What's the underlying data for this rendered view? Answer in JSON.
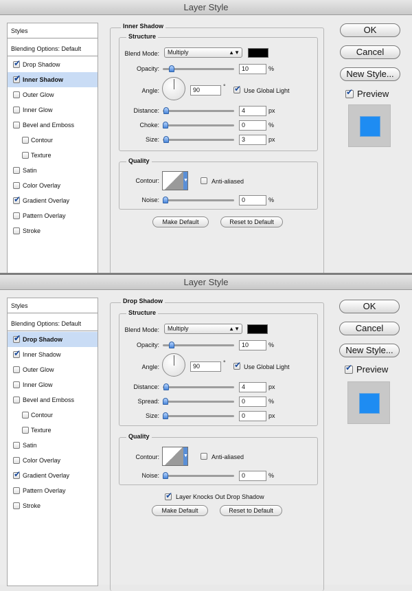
{
  "dialogs": [
    {
      "title": "Layer Style",
      "sidebar": {
        "header": "Styles",
        "blending": "Blending Options: Default",
        "items": [
          {
            "label": "Drop Shadow",
            "checked": true,
            "selected": false,
            "sub": false
          },
          {
            "label": "Inner Shadow",
            "checked": true,
            "selected": true,
            "sub": false
          },
          {
            "label": "Outer Glow",
            "checked": false,
            "selected": false,
            "sub": false
          },
          {
            "label": "Inner Glow",
            "checked": false,
            "selected": false,
            "sub": false
          },
          {
            "label": "Bevel and Emboss",
            "checked": false,
            "selected": false,
            "sub": false
          },
          {
            "label": "Contour",
            "checked": false,
            "selected": false,
            "sub": true
          },
          {
            "label": "Texture",
            "checked": false,
            "selected": false,
            "sub": true
          },
          {
            "label": "Satin",
            "checked": false,
            "selected": false,
            "sub": false
          },
          {
            "label": "Color Overlay",
            "checked": false,
            "selected": false,
            "sub": false
          },
          {
            "label": "Gradient Overlay",
            "checked": true,
            "selected": false,
            "sub": false
          },
          {
            "label": "Pattern Overlay",
            "checked": false,
            "selected": false,
            "sub": false
          },
          {
            "label": "Stroke",
            "checked": false,
            "selected": false,
            "sub": false
          }
        ]
      },
      "panel_title": "Inner Shadow",
      "structure": {
        "title": "Structure",
        "blend_mode_label": "Blend Mode:",
        "blend_mode_value": "Multiply",
        "color": "#000000",
        "opacity_label": "Opacity:",
        "opacity_value": "10",
        "opacity_unit": "%",
        "angle_label": "Angle:",
        "angle_value": "90",
        "angle_unit": "°",
        "use_global_light": "Use Global Light",
        "distance_label": "Distance:",
        "distance_value": "4",
        "distance_unit": "px",
        "third_label": "Choke:",
        "third_value": "0",
        "third_unit": "%",
        "size_label": "Size:",
        "size_value": "3",
        "size_unit": "px"
      },
      "quality": {
        "title": "Quality",
        "contour_label": "Contour:",
        "anti_aliased": "Anti-aliased",
        "noise_label": "Noise:",
        "noise_value": "0",
        "noise_unit": "%"
      },
      "make_default": "Make Default",
      "reset_to_default": "Reset to Default",
      "buttons": {
        "ok": "OK",
        "cancel": "Cancel",
        "new_style": "New Style...",
        "preview": "Preview"
      },
      "preview_color": "#1e8cf2"
    },
    {
      "title": "Layer Style",
      "sidebar": {
        "header": "Styles",
        "blending": "Blending Options: Default",
        "items": [
          {
            "label": "Drop Shadow",
            "checked": true,
            "selected": true,
            "sub": false
          },
          {
            "label": "Inner Shadow",
            "checked": true,
            "selected": false,
            "sub": false
          },
          {
            "label": "Outer Glow",
            "checked": false,
            "selected": false,
            "sub": false
          },
          {
            "label": "Inner Glow",
            "checked": false,
            "selected": false,
            "sub": false
          },
          {
            "label": "Bevel and Emboss",
            "checked": false,
            "selected": false,
            "sub": false
          },
          {
            "label": "Contour",
            "checked": false,
            "selected": false,
            "sub": true
          },
          {
            "label": "Texture",
            "checked": false,
            "selected": false,
            "sub": true
          },
          {
            "label": "Satin",
            "checked": false,
            "selected": false,
            "sub": false
          },
          {
            "label": "Color Overlay",
            "checked": false,
            "selected": false,
            "sub": false
          },
          {
            "label": "Gradient Overlay",
            "checked": true,
            "selected": false,
            "sub": false
          },
          {
            "label": "Pattern Overlay",
            "checked": false,
            "selected": false,
            "sub": false
          },
          {
            "label": "Stroke",
            "checked": false,
            "selected": false,
            "sub": false
          }
        ]
      },
      "panel_title": "Drop Shadow",
      "structure": {
        "title": "Structure",
        "blend_mode_label": "Blend Mode:",
        "blend_mode_value": "Multiply",
        "color": "#000000",
        "opacity_label": "Opacity:",
        "opacity_value": "10",
        "opacity_unit": "%",
        "angle_label": "Angle:",
        "angle_value": "90",
        "angle_unit": "°",
        "use_global_light": "Use Global Light",
        "distance_label": "Distance:",
        "distance_value": "4",
        "distance_unit": "px",
        "third_label": "Spread:",
        "third_value": "0",
        "third_unit": "%",
        "size_label": "Size:",
        "size_value": "0",
        "size_unit": "px"
      },
      "quality": {
        "title": "Quality",
        "contour_label": "Contour:",
        "anti_aliased": "Anti-aliased",
        "noise_label": "Noise:",
        "noise_value": "0",
        "noise_unit": "%"
      },
      "layer_knocks_out": "Layer Knocks Out Drop Shadow",
      "make_default": "Make Default",
      "reset_to_default": "Reset to Default",
      "buttons": {
        "ok": "OK",
        "cancel": "Cancel",
        "new_style": "New Style...",
        "preview": "Preview"
      },
      "preview_color": "#1e8cf2"
    }
  ]
}
